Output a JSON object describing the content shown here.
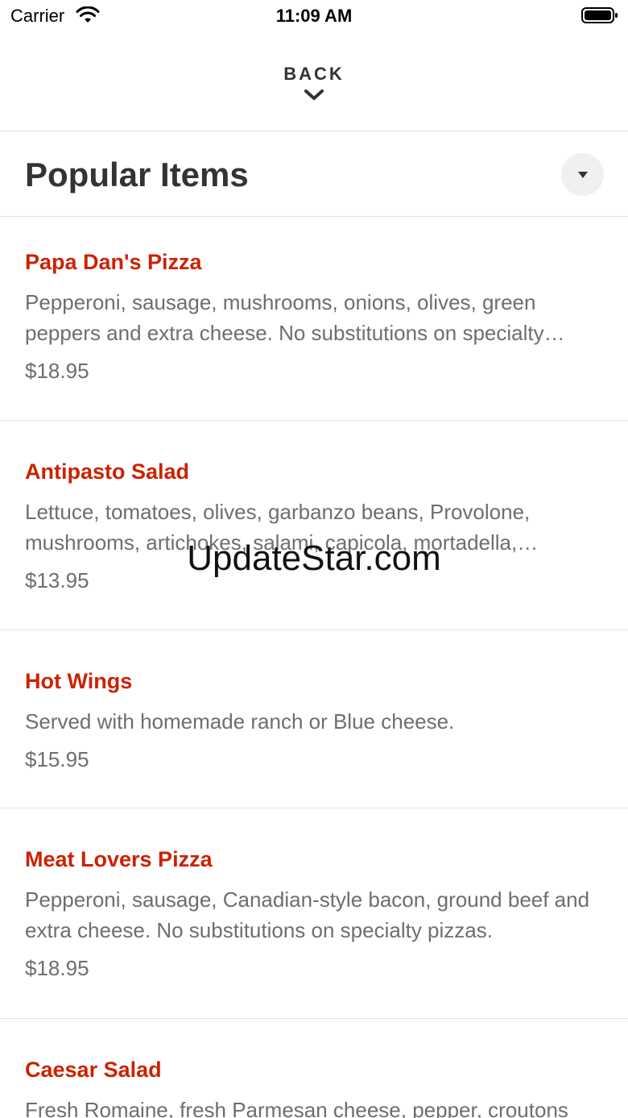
{
  "status_bar": {
    "carrier": "Carrier",
    "time": "11:09 AM",
    "wifi_icon": "wifi-icon",
    "battery_icon": "battery-icon"
  },
  "nav": {
    "back_label": "BACK",
    "chevron_icon": "chevron-down-icon"
  },
  "section": {
    "title": "Popular Items",
    "collapse_icon": "triangle-down-icon"
  },
  "items": [
    {
      "name": "Papa Dan's Pizza",
      "description": "Pepperoni, sausage, mushrooms, onions, olives, green peppers and extra cheese. No substitutions on specialty pizzas.",
      "price": "$18.95"
    },
    {
      "name": "Antipasto Salad",
      "description": "Lettuce, tomatoes, olives, garbanzo beans, Provolone, mushrooms, artichokes, salami, capicola, mortadella, pepperoncini.",
      "price": "$13.95"
    },
    {
      "name": "Hot Wings",
      "description": "Served with homemade ranch or Blue cheese.",
      "price": "$15.95"
    },
    {
      "name": "Meat Lovers Pizza",
      "description": "Pepperoni, sausage, Canadian-style bacon, ground beef and extra cheese. No substitutions on specialty pizzas.",
      "price": "$18.95"
    },
    {
      "name": "Caesar Salad",
      "description": "Fresh Romaine, fresh Parmesan cheese, pepper, croutons",
      "price": ""
    }
  ],
  "watermark": "UpdateStar.com",
  "colors": {
    "accent": "#cc2200",
    "text_primary": "#333333",
    "text_secondary": "#6e6e6e",
    "divider": "#e2e2e2"
  }
}
